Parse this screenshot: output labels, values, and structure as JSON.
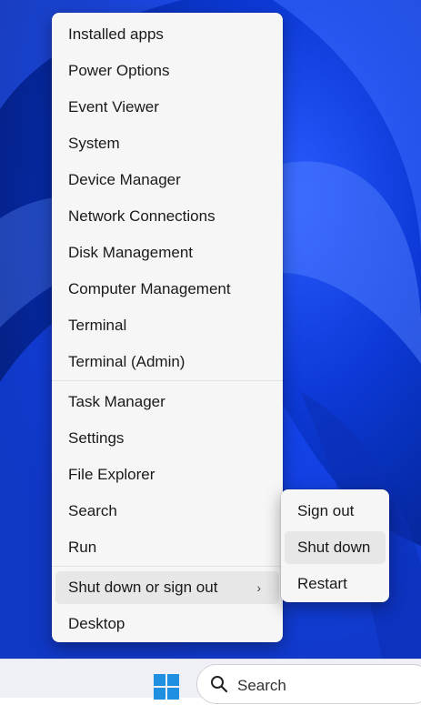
{
  "menu": {
    "items": [
      {
        "label": "Installed apps"
      },
      {
        "label": "Power Options"
      },
      {
        "label": "Event Viewer"
      },
      {
        "label": "System"
      },
      {
        "label": "Device Manager"
      },
      {
        "label": "Network Connections"
      },
      {
        "label": "Disk Management"
      },
      {
        "label": "Computer Management"
      },
      {
        "label": "Terminal"
      },
      {
        "label": "Terminal (Admin)"
      },
      {
        "label": "Task Manager"
      },
      {
        "label": "Settings"
      },
      {
        "label": "File Explorer"
      },
      {
        "label": "Search"
      },
      {
        "label": "Run"
      },
      {
        "label": "Shut down or sign out"
      },
      {
        "label": "Desktop"
      }
    ],
    "chevron": "›"
  },
  "submenu": {
    "items": [
      {
        "label": "Sign out"
      },
      {
        "label": "Shut down"
      },
      {
        "label": "Restart"
      }
    ]
  },
  "taskbar": {
    "search_label": "Search"
  },
  "icons": {
    "start": "windows-logo-icon",
    "search": "magnifier-icon"
  },
  "colors": {
    "menu_bg": "#f6f6f6",
    "hover_bg": "#e7e7e7",
    "wallpaper_accent": "#0d3ad8",
    "windows_logo": "#1e8fe1"
  }
}
